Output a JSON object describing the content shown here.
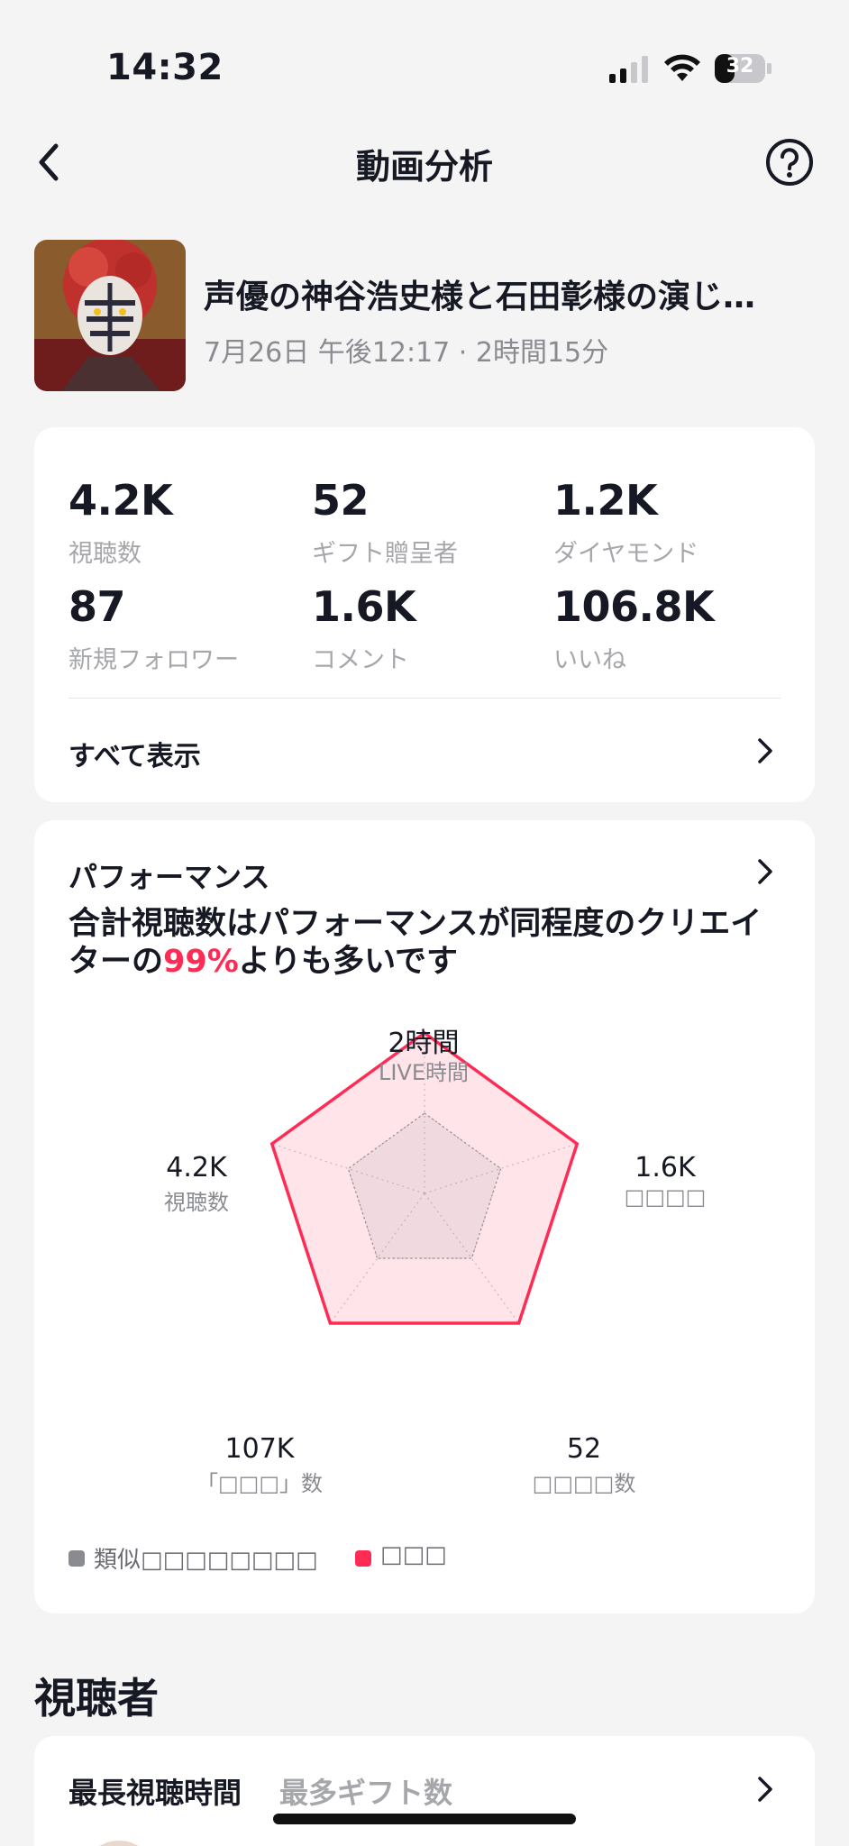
{
  "status_bar": {
    "time": "14:32",
    "battery": "32"
  },
  "nav": {
    "title": "動画分析"
  },
  "video": {
    "title": "声優の神谷浩史様と石田彰様の演じ…",
    "meta": "7月26日 午後12:17 · 2時間15分"
  },
  "stats": [
    {
      "value": "4.2K",
      "label": "視聴数"
    },
    {
      "value": "52",
      "label": "ギフト贈呈者"
    },
    {
      "value": "1.2K",
      "label": "ダイヤモンド"
    },
    {
      "value": "87",
      "label": "新規フォロワー"
    },
    {
      "value": "1.6K",
      "label": "コメント"
    },
    {
      "value": "106.8K",
      "label": "いいね"
    }
  ],
  "show_all": "すべて表示",
  "performance": {
    "title": "パフォーマンス",
    "summary_before": "合計視聴数はパフォーマンスが同程度のクリエイターの",
    "summary_highlight": "99%",
    "summary_after": "よりも多いです",
    "axes": [
      {
        "value": "2時間",
        "label": "LIVE時間"
      },
      {
        "value": "1.6K",
        "label": "□□□□"
      },
      {
        "value": "52",
        "label": "□□□□数"
      },
      {
        "value": "107K",
        "label": "「□□□」数"
      },
      {
        "value": "4.2K",
        "label": "視聴数"
      }
    ],
    "legend": [
      {
        "label": "類似□□□□□□□□",
        "color": "#8a8b91"
      },
      {
        "label": "□□□",
        "color": "#fe2c55"
      }
    ],
    "colors": {
      "accent": "#fe2c55",
      "similar": "#8a8b91"
    },
    "levels": {
      "user": [
        1.0,
        1.0,
        1.0,
        1.0,
        1.0
      ],
      "similar": [
        0.5,
        0.5,
        0.5,
        0.5,
        0.5
      ]
    }
  },
  "viewers": {
    "title": "視聴者",
    "tabs": [
      "最長視聴時間",
      "最多ギフト数"
    ]
  }
}
